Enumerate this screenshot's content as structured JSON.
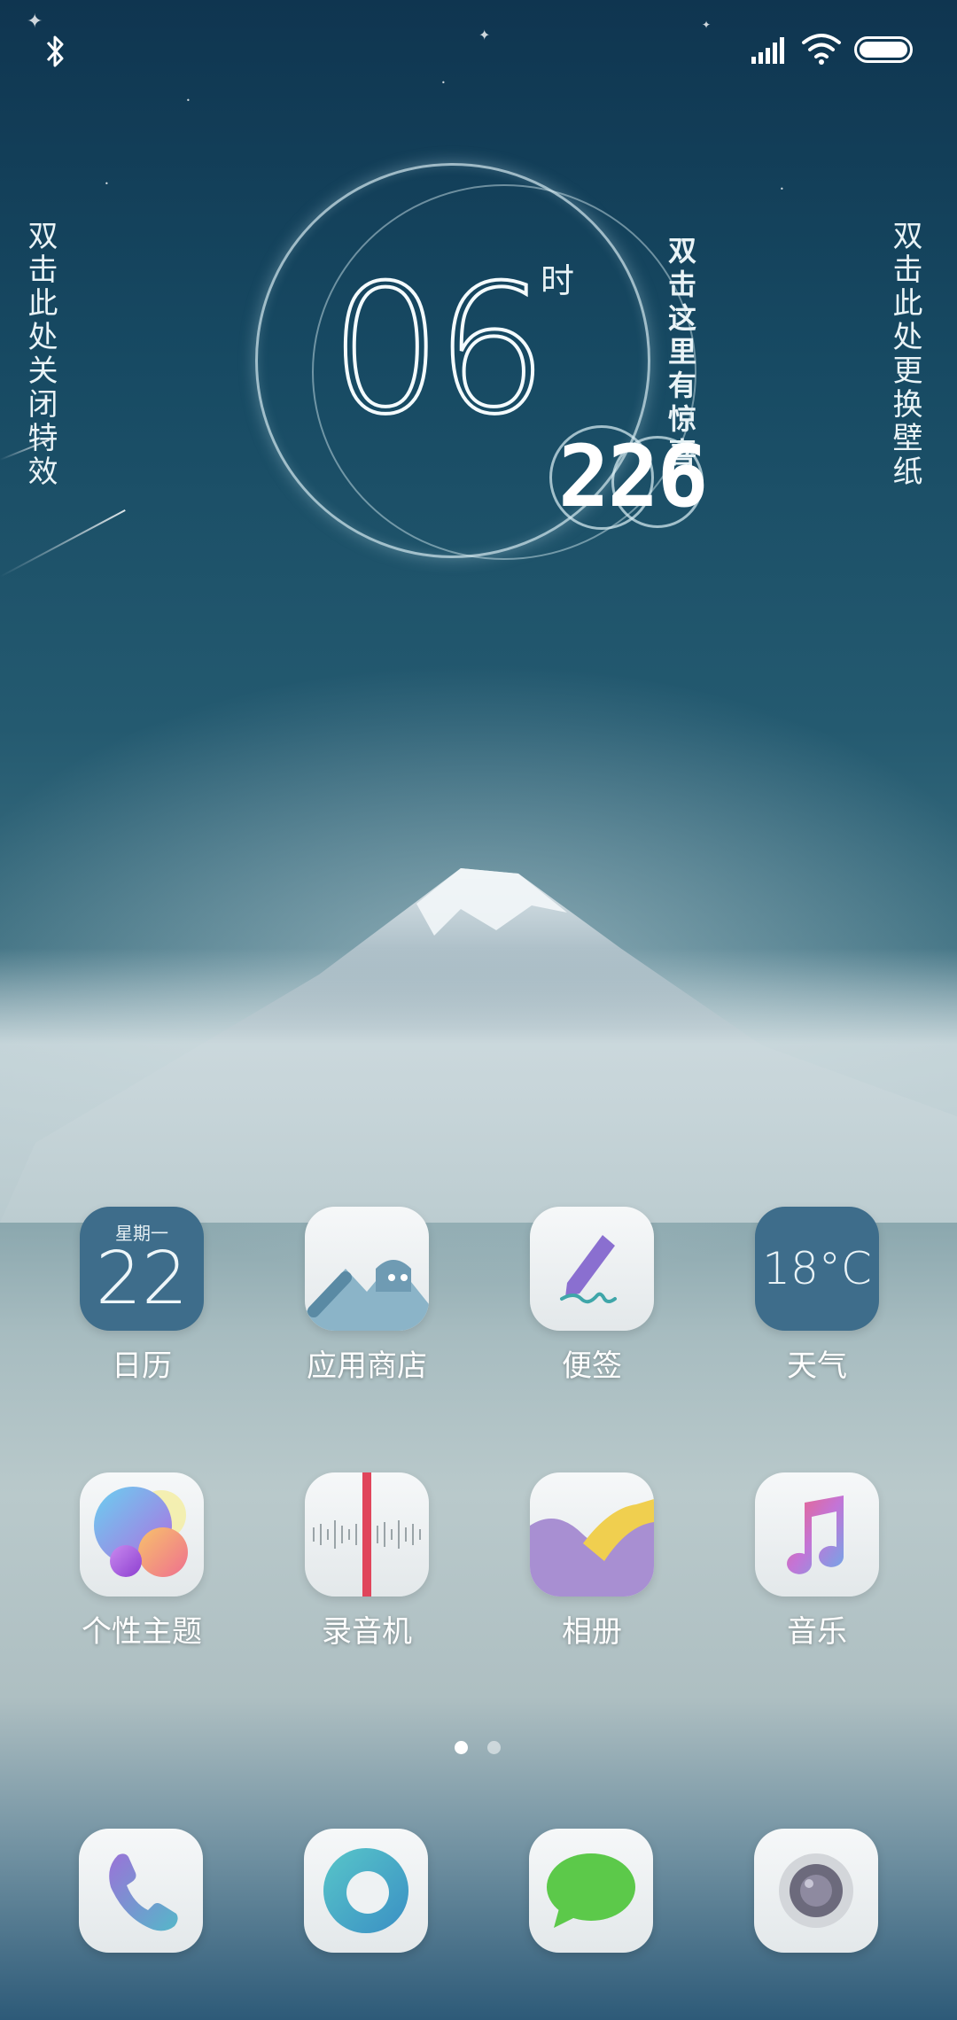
{
  "status_bar": {
    "bluetooth_icon": "bluetooth-icon",
    "signal_icon": "signal-bars-icon",
    "wifi_icon": "wifi-icon",
    "battery_icon": "battery-icon",
    "battery_level": 1.0
  },
  "wallpaper": {
    "left_hint": "双击此处关闭特效",
    "right_hint": "双击此处更换壁纸",
    "surprise_hint": "双击这里有惊喜"
  },
  "clock": {
    "hour": "06",
    "hour_label": "时",
    "minute": "226"
  },
  "apps": [
    {
      "id": "calendar",
      "label": "日历",
      "weekday": "星期一",
      "date": "22"
    },
    {
      "id": "app-store",
      "label": "应用商店"
    },
    {
      "id": "notes",
      "label": "便签"
    },
    {
      "id": "weather",
      "label": "天气",
      "temperature": "18°C"
    },
    {
      "id": "themes",
      "label": "个性主题"
    },
    {
      "id": "recorder",
      "label": "录音机"
    },
    {
      "id": "gallery",
      "label": "相册"
    },
    {
      "id": "music",
      "label": "音乐"
    }
  ],
  "pager": {
    "pages": 2,
    "current": 1
  },
  "dock": [
    {
      "id": "phone",
      "icon": "phone-icon"
    },
    {
      "id": "browser",
      "icon": "browser-icon"
    },
    {
      "id": "messages",
      "icon": "message-icon"
    },
    {
      "id": "camera",
      "icon": "camera-icon"
    }
  ],
  "colors": {
    "sky_top": "#0f3550",
    "calendar_tile": "#3e6d8b",
    "weather_tile": "#3e6d8b",
    "recorder_red": "#e0455b",
    "message_green": "#5cc94a"
  }
}
